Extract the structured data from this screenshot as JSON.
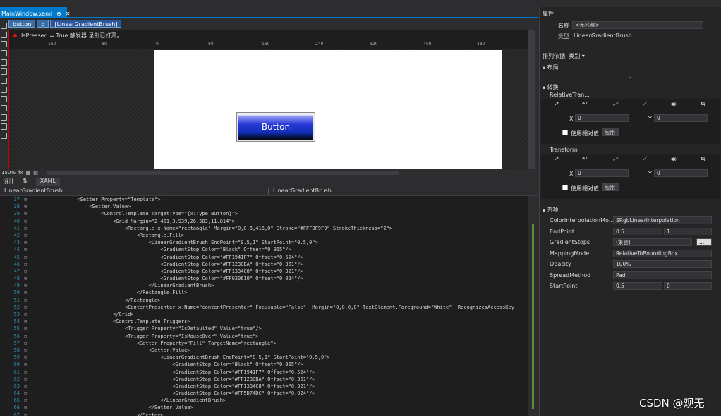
{
  "document_tab": "MainWindow.xaml",
  "breadcrumb": [
    "button",
    "",
    "[LinearGradientBrush]"
  ],
  "designer": {
    "message": "IsPressed = True 触发器 录制已打开。",
    "ruler_ticks": [
      "160",
      "80",
      "0",
      "80",
      "160",
      "240",
      "320",
      "400",
      "480"
    ],
    "button_label": "Button",
    "zoom": "150%"
  },
  "view_tabs": {
    "design": "设计",
    "swap": "⇅",
    "xaml": "XAML"
  },
  "xaml_header": {
    "left": "LinearGradientBrush",
    "right": "LinearGradientBrush"
  },
  "code_lines": [
    {
      "n": "37",
      "t": "                <Setter Property=\"Template\">"
    },
    {
      "n": "38",
      "t": "                    <Setter.Value>"
    },
    {
      "n": "39",
      "t": "                        <ControlTemplate TargetType=\"{x:Type Button}\">"
    },
    {
      "n": "40",
      "t": "                            <Grid Margin=\"2.461,3.939,26.583,11.814\">"
    },
    {
      "n": "41",
      "t": "                                <Rectangle x:Name=\"rectangle\" Margin=\"0,0.5,415,0\" Stroke=\"#FFFBF9F9\" StrokeThickness=\"2\">"
    },
    {
      "n": "42",
      "t": "                                    <Rectangle.Fill>"
    },
    {
      "n": "43",
      "t": "                                        <LinearGradientBrush EndPoint=\"0.5,1\" StartPoint=\"0.5,0\">"
    },
    {
      "n": "44",
      "t": "                                            <GradientStop Color=\"Black\" Offset=\"0.965\"/>"
    },
    {
      "n": "45",
      "t": "                                            <GradientStop Color=\"#FF1941F7\" Offset=\"0.524\"/>"
    },
    {
      "n": "46",
      "t": "                                            <GradientStop Color=\"#FF1230BA\" Offset=\"0.361\"/>"
    },
    {
      "n": "47",
      "t": "                                            <GradientStop Color=\"#FF1334C8\" Offset=\"0.321\"/>"
    },
    {
      "n": "48",
      "t": "                                            <GradientStop Color=\"#FF020610\" Offset=\"0.024\"/>"
    },
    {
      "n": "49",
      "t": "                                        </LinearGradientBrush>"
    },
    {
      "n": "50",
      "t": "                                    </Rectangle.Fill>"
    },
    {
      "n": "51",
      "t": "                                </Rectangle>"
    },
    {
      "n": "52",
      "t": "                                <ContentPresenter x:Name=\"contentPresenter\" Focusable=\"False\"  Margin=\"0,0,0,0\" TextElement.Foreground=\"White\"  RecognizesAccessKey"
    },
    {
      "n": "53",
      "t": "                            </Grid>"
    },
    {
      "n": "54",
      "t": "                            <ControlTemplate.Triggers>"
    },
    {
      "n": "55",
      "t": "                                <Trigger Property=\"IsDefaulted\" Value=\"true\"/>"
    },
    {
      "n": "56",
      "t": "                                <Trigger Property=\"IsMouseOver\" Value=\"true\">"
    },
    {
      "n": "57",
      "t": "                                    <Setter Property=\"Fill\" TargetName=\"rectangle\">"
    },
    {
      "n": "58",
      "t": "                                        <Setter.Value>"
    },
    {
      "n": "59",
      "t": "                                            <LinearGradientBrush EndPoint=\"0.5,1\" StartPoint=\"0.5,0\">"
    },
    {
      "n": "60",
      "t": "                                                <GradientStop Color=\"Black\" Offset=\"0.965\"/>"
    },
    {
      "n": "61",
      "t": "                                                <GradientStop Color=\"#FF1941F7\" Offset=\"0.524\"/>"
    },
    {
      "n": "62",
      "t": "                                                <GradientStop Color=\"#FF1230BA\" Offset=\"0.361\"/>"
    },
    {
      "n": "63",
      "t": "                                                <GradientStop Color=\"#FF1334C8\" Offset=\"0.321\"/>"
    },
    {
      "n": "64",
      "t": "                                                <GradientStop Color=\"#FF5D74DC\" Offset=\"0.024\"/>"
    },
    {
      "n": "65",
      "t": "                                            </LinearGradientBrush>"
    },
    {
      "n": "66",
      "t": "                                        </Setter.Value>"
    },
    {
      "n": "67",
      "t": "                                    </Setter>"
    }
  ],
  "properties": {
    "panel_title": "属性",
    "name_label": "名称",
    "name_value": "<无名称>",
    "type_label": "类型",
    "type_value": "LinearGradientBrush",
    "arrange_by": "排列依据: 类别 ▾",
    "layout": "布局",
    "transform": "转换",
    "relative_transform": "RelativeTran...",
    "x_label": "X",
    "y_label": "Y",
    "x1": "0",
    "y1": "0",
    "x2": "0",
    "y2": "0",
    "use_relative": "使用相对值",
    "apply": "应用",
    "transform_label": "Transform",
    "misc": "杂项",
    "rows": [
      {
        "k": "ColorInterpolationMo...",
        "v": "SRgbLinearInterpolation"
      },
      {
        "k": "EndPoint",
        "v": "0.5",
        "v2": "1"
      },
      {
        "k": "GradientStops",
        "v": "(集合)",
        "btn": "..."
      },
      {
        "k": "MappingMode",
        "v": "RelativeToBoundingBox"
      },
      {
        "k": "Opacity",
        "v": "100%"
      },
      {
        "k": "SpreadMethod",
        "v": "Pad"
      },
      {
        "k": "StartPoint",
        "v": "0.5",
        "v2": "0"
      }
    ]
  },
  "watermark": "CSDN @观无",
  "colors": {
    "accent": "#007acc",
    "error": "#e51400",
    "line_number": "#2b91af"
  }
}
